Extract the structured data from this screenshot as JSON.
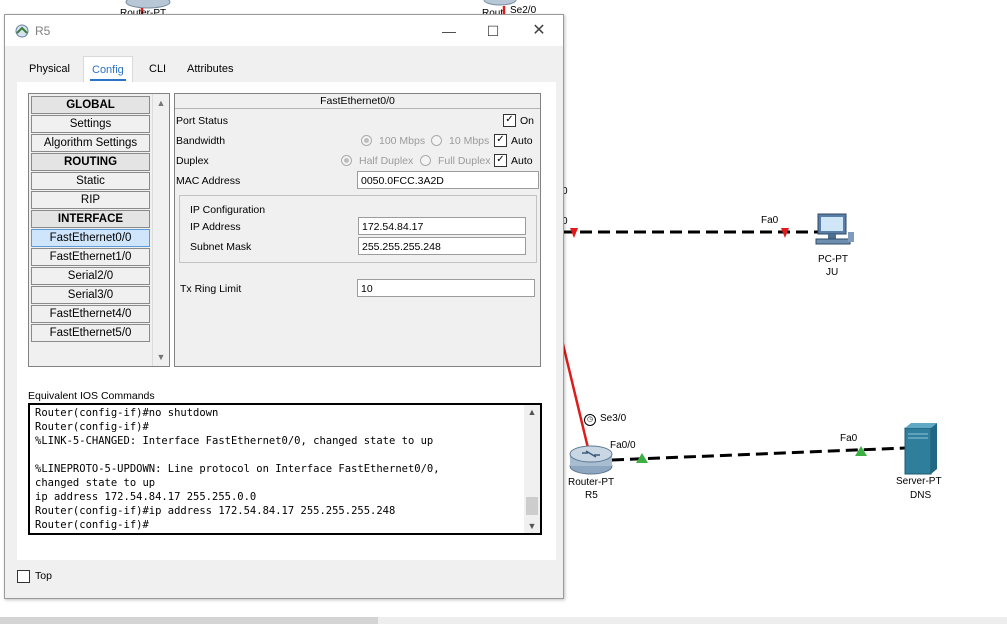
{
  "dialog": {
    "title": "R5",
    "tabs": [
      "Physical",
      "Config",
      "CLI",
      "Attributes"
    ],
    "active_tab": "Config"
  },
  "leftlist": {
    "items": [
      "GLOBAL",
      "Settings",
      "Algorithm Settings",
      "ROUTING",
      "Static",
      "RIP",
      "INTERFACE",
      "FastEthernet0/0",
      "FastEthernet1/0",
      "Serial2/0",
      "Serial3/0",
      "FastEthernet4/0",
      "FastEthernet5/0"
    ],
    "selected": "FastEthernet0/0"
  },
  "interface": {
    "title": "FastEthernet0/0",
    "port_status_label": "Port Status",
    "on_label": "On",
    "bandwidth_label": "Bandwidth",
    "bw_100": "100 Mbps",
    "bw_10": "10 Mbps",
    "auto_label": "Auto",
    "duplex_label": "Duplex",
    "half_duplex": "Half Duplex",
    "full_duplex": "Full Duplex",
    "mac_label": "MAC Address",
    "mac_value": "0050.0FCC.3A2D",
    "ip_config_label": "IP Configuration",
    "ip_label": "IP Address",
    "ip_value": "172.54.84.17",
    "mask_label": "Subnet Mask",
    "mask_value": "255.255.255.248",
    "tx_label": "Tx Ring Limit",
    "tx_value": "10"
  },
  "ios": {
    "label": "Equivalent IOS Commands",
    "lines": [
      "Router(config-if)#no shutdown",
      "Router(config-if)#",
      "%LINK-5-CHANGED: Interface FastEthernet0/0, changed state to up",
      "",
      "%LINEPROTO-5-UPDOWN: Line protocol on Interface FastEthernet0/0,",
      "changed state to up",
      "ip address 172.54.84.17 255.255.0.0",
      "Router(config-if)#ip address 172.54.84.17 255.255.255.248",
      "Router(config-if)#"
    ]
  },
  "top_label": "Top",
  "topology": {
    "top_router_label": "Router-PT",
    "top_router2_label": "Rout",
    "top_se_label": "Se2/0",
    "link_fa0_pc": "Fa0",
    "pc_label": "PC-PT",
    "pc_name": "JU",
    "se30": "Se3/0",
    "fa00": "Fa0/0",
    "router_type": "Router-PT",
    "router_name": "R5",
    "fa0_server": "Fa0",
    "server_type": "Server-PT",
    "server_name": "DNS",
    "partial0": "0",
    "partial1": "0"
  },
  "colors": {
    "accent": "#2b73c4",
    "link_red": "#e01b1b",
    "link_green": "#3cb043"
  }
}
